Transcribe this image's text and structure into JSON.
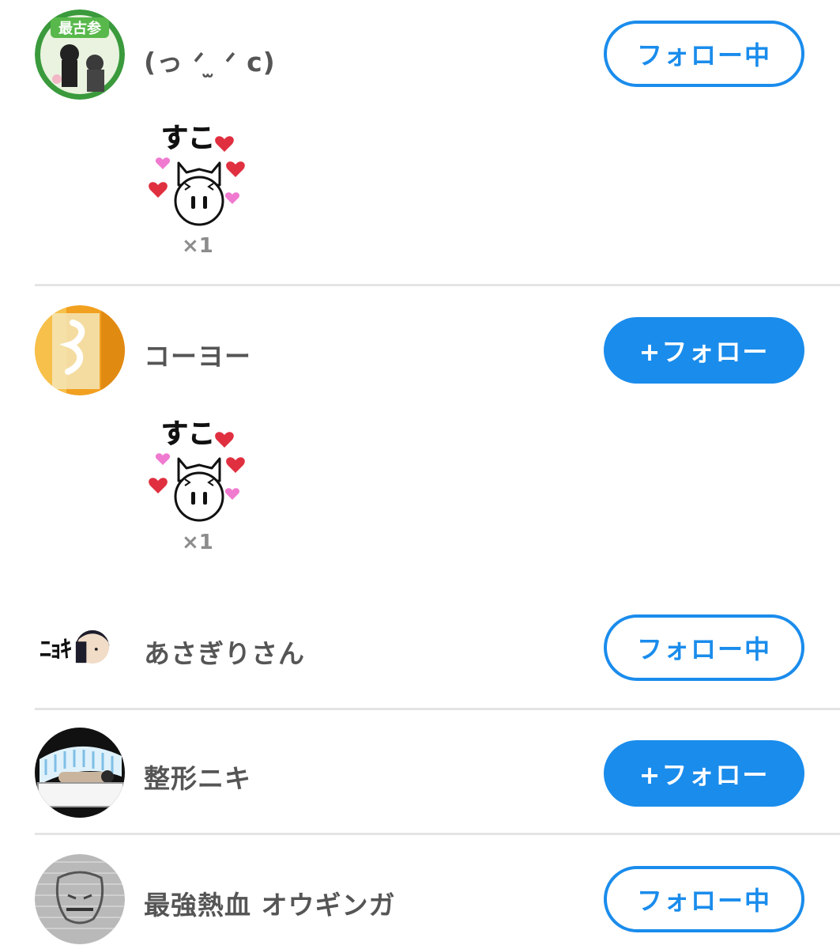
{
  "colors": {
    "accent": "#1a8cec",
    "username": "#555555",
    "divider": "#e4e4e4",
    "count": "#8c8c8c"
  },
  "stamp": {
    "text": "すこ",
    "icon": "cat-heart-sticker"
  },
  "users": [
    {
      "name": "(っ ᐟ ̫ ᐟ c)",
      "button": "フォロー中",
      "state": "following",
      "avatar_text": "最古参",
      "reaction_count": "×1"
    },
    {
      "name": "コーヨー",
      "button": "+フォロー",
      "state": "not-following",
      "reaction_count": "×1"
    },
    {
      "name": "あさぎりさん",
      "button": "フォロー中",
      "state": "following",
      "avatar_text": "ﾆｮｷ"
    },
    {
      "name": "整形ニキ",
      "button": "+フォロー",
      "state": "not-following"
    },
    {
      "name": "最強熱血 オウギンガ",
      "button": "フォロー中",
      "state": "following"
    }
  ]
}
